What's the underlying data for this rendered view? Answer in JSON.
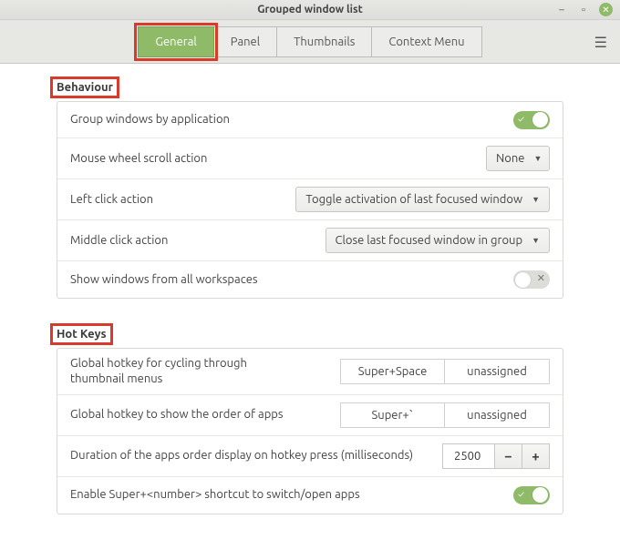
{
  "window": {
    "title": "Grouped window list"
  },
  "tabs": {
    "general": "General",
    "panel": "Panel",
    "thumbnails": "Thumbnails",
    "context_menu": "Context Menu"
  },
  "behaviour": {
    "heading": "Behaviour",
    "group_by_app": "Group windows by application",
    "mouse_wheel": "Mouse wheel scroll action",
    "mouse_wheel_value": "None",
    "left_click": "Left click action",
    "left_click_value": "Toggle activation of last focused window",
    "middle_click": "Middle click action",
    "middle_click_value": "Close last focused window in group",
    "show_all_ws": "Show windows from all workspaces"
  },
  "hotkeys": {
    "heading": "Hot Keys",
    "cycle_thumb": "Global hotkey for cycling through thumbnail menus",
    "cycle_thumb_k1": "Super+Space",
    "cycle_thumb_k2": "unassigned",
    "show_order": "Global hotkey to show the order of apps",
    "show_order_k1": "Super+`",
    "show_order_k2": "unassigned",
    "duration": "Duration of the apps order display on hotkey press (milliseconds)",
    "duration_value": "2500",
    "enable_super_num": "Enable Super+<number> shortcut to switch/open apps"
  }
}
